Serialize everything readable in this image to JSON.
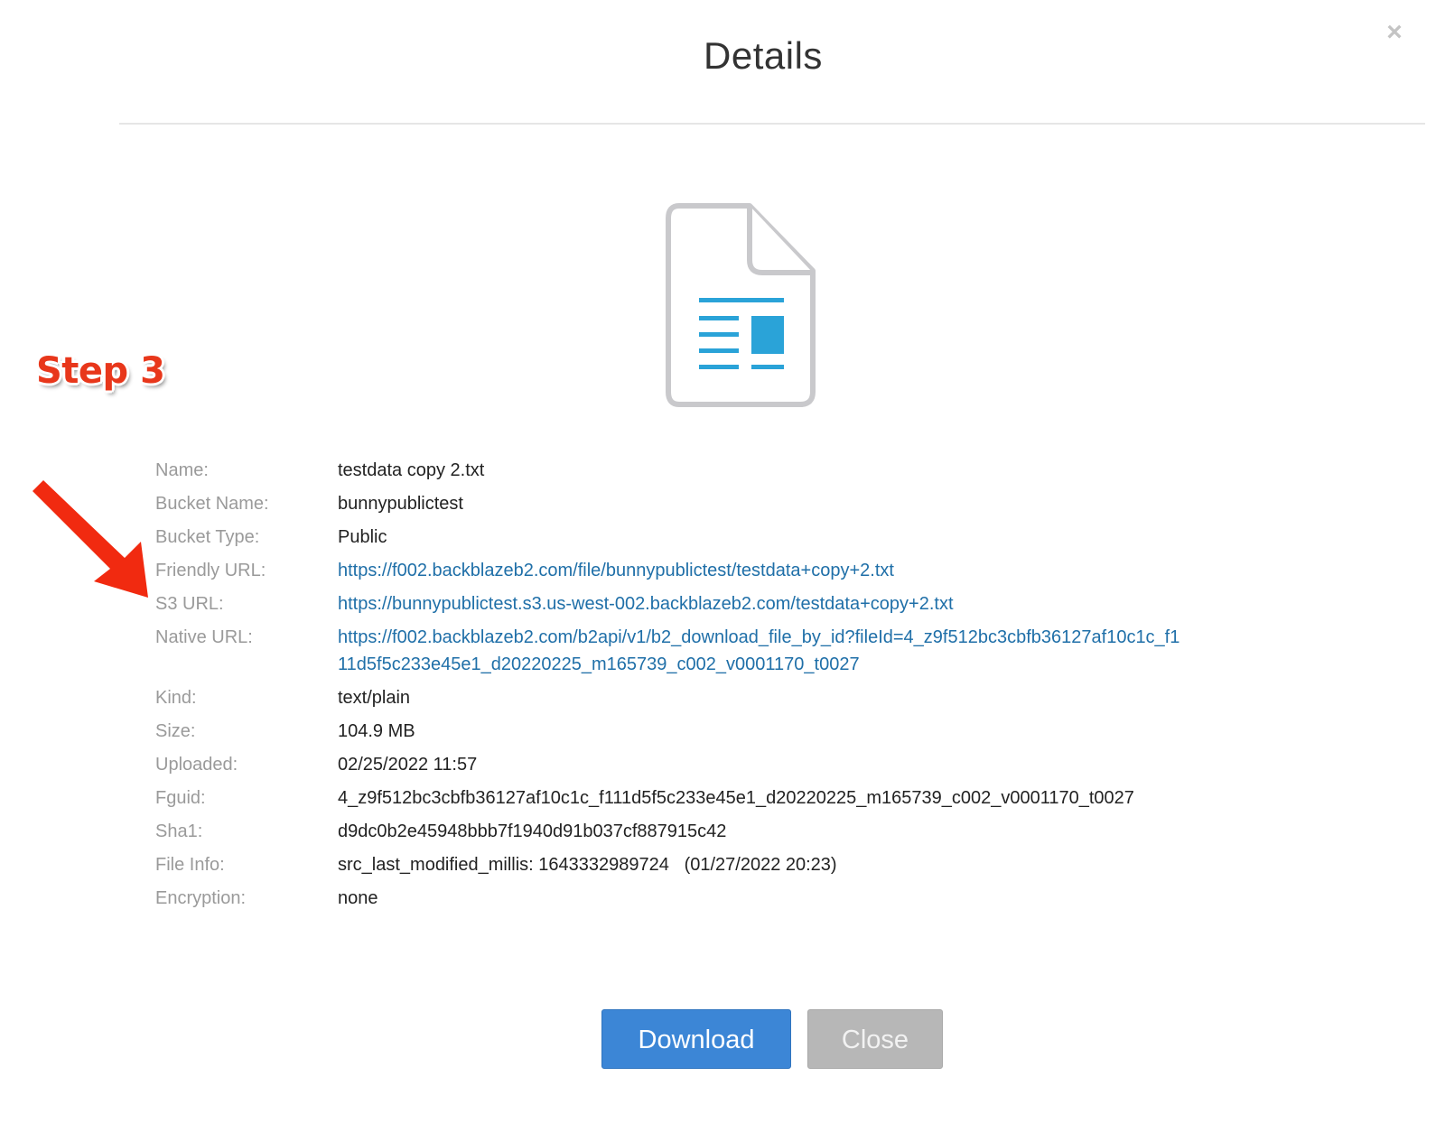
{
  "modal": {
    "title": "Details",
    "close_glyph": "×"
  },
  "annotation": {
    "step_label": "Step 3",
    "arrow_color": "#e8371b"
  },
  "file_icon": {
    "name": "text-document-icon",
    "accent_color": "#2aa3d8"
  },
  "details": {
    "name_label": "Name:",
    "name_value": "testdata copy 2.txt",
    "bucket_name_label": "Bucket Name:",
    "bucket_name_value": "bunnypublictest",
    "bucket_type_label": "Bucket Type:",
    "bucket_type_value": "Public",
    "friendly_url_label": "Friendly URL:",
    "friendly_url_value": "https://f002.backblazeb2.com/file/bunnypublictest/testdata+copy+2.txt",
    "s3_url_label": "S3 URL:",
    "s3_url_value": "https://bunnypublictest.s3.us-west-002.backblazeb2.com/testdata+copy+2.txt",
    "native_url_label": "Native URL:",
    "native_url_value": "https://f002.backblazeb2.com/b2api/v1/b2_download_file_by_id?fileId=4_z9f512bc3cbfb36127af10c1c_f111d5f5c233e45e1_d20220225_m165739_c002_v0001170_t0027",
    "kind_label": "Kind:",
    "kind_value": "text/plain",
    "size_label": "Size:",
    "size_value": "104.9 MB",
    "uploaded_label": "Uploaded:",
    "uploaded_value": "02/25/2022 11:57",
    "fguid_label": "Fguid:",
    "fguid_value": "4_z9f512bc3cbfb36127af10c1c_f111d5f5c233e45e1_d20220225_m165739_c002_v0001170_t0027",
    "sha1_label": "Sha1:",
    "sha1_value": "d9dc0b2e45948bbb7f1940d91b037cf887915c42",
    "file_info_label": "File Info:",
    "file_info_value": "src_last_modified_millis: 1643332989724   (01/27/2022 20:23)",
    "encryption_label": "Encryption:",
    "encryption_value": "none"
  },
  "buttons": {
    "download_label": "Download",
    "close_label": "Close",
    "download_color": "#3c86d6",
    "close_color": "#b7b7b7"
  }
}
